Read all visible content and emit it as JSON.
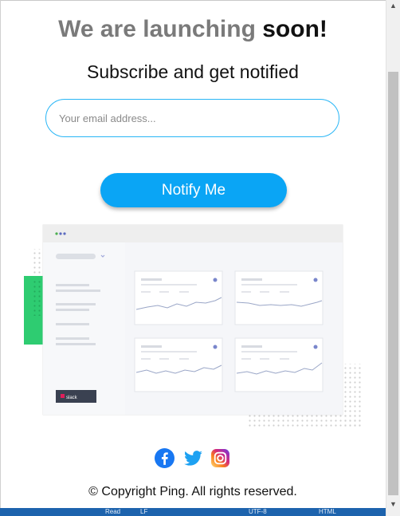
{
  "headline": {
    "regular": "We are launching ",
    "bold": "soon!"
  },
  "subheading": "Subscribe and get notified",
  "email_input": {
    "placeholder": "Your email address...",
    "value": ""
  },
  "notify_button": {
    "label": "Notify Me"
  },
  "illustration": {
    "slack_badge": "slack"
  },
  "social": [
    {
      "name": "facebook",
      "icon": "facebook-icon",
      "color": "#1877f2"
    },
    {
      "name": "twitter",
      "icon": "twitter-icon",
      "color": "#1da1f2"
    },
    {
      "name": "instagram",
      "icon": "instagram-icon",
      "color": "#e1306c"
    }
  ],
  "copyright": "© Copyright Ping. All rights reserved.",
  "status_bar": [
    "Read",
    "LF",
    "UTF-8",
    "HTML"
  ],
  "colors": {
    "accent": "#0aa5f5",
    "input_border": "#29b6f6",
    "green_block": "#2ecc71",
    "status_bar": "#1d63ad"
  }
}
